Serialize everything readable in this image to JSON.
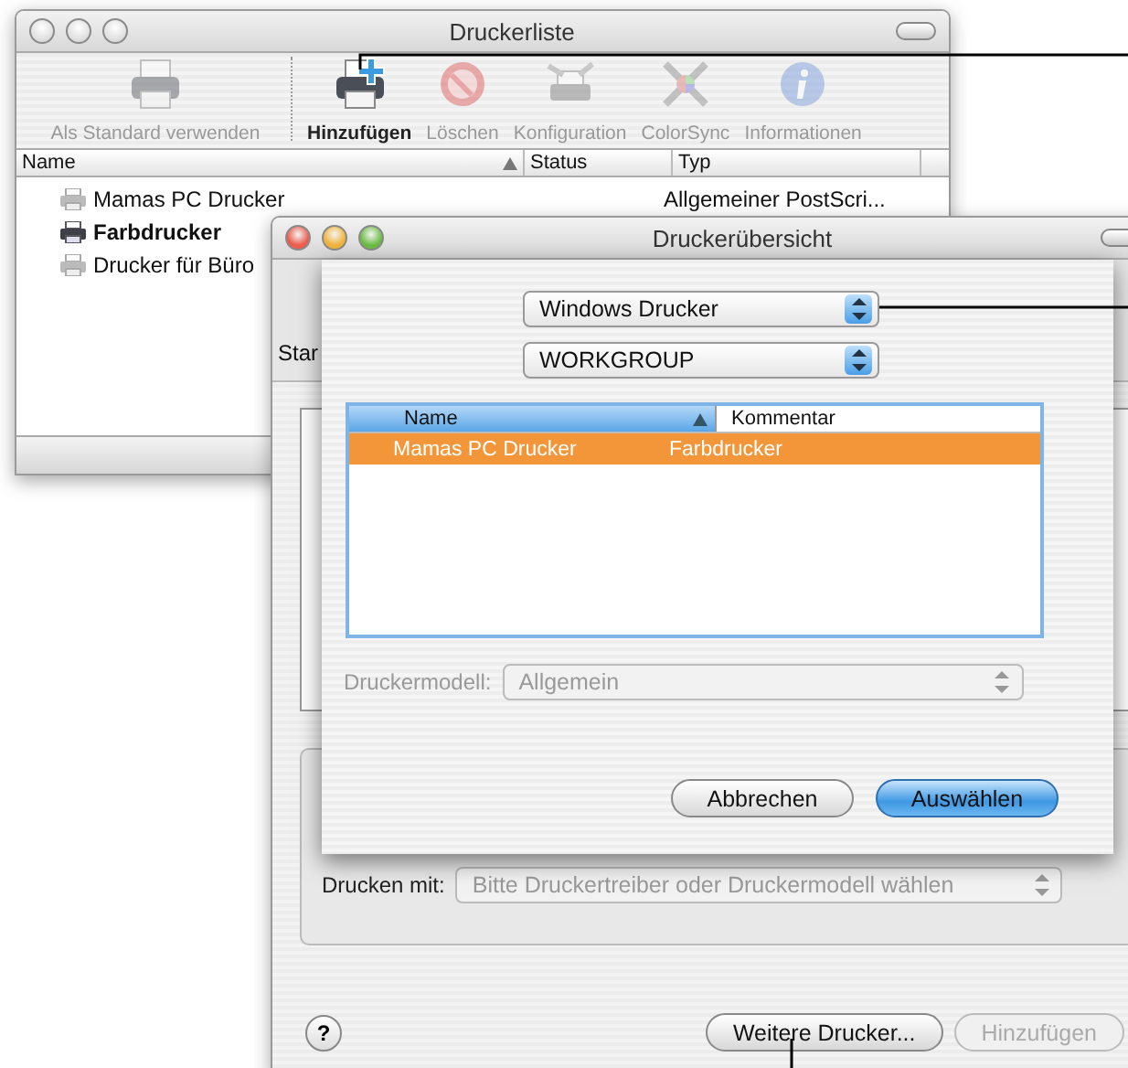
{
  "printer_list_window": {
    "title": "Druckerliste",
    "active": false,
    "toolbar": [
      {
        "label": "Als Standard verwenden",
        "disabled": true
      },
      {
        "label": "Hinzufügen",
        "disabled": false
      },
      {
        "label": "Löschen",
        "disabled": true
      },
      {
        "label": "Konfiguration",
        "disabled": true
      },
      {
        "label": "ColorSync",
        "disabled": true
      },
      {
        "label": "Informationen",
        "disabled": true
      }
    ],
    "columns": [
      "Name",
      "Status",
      "Typ"
    ],
    "rows": [
      {
        "name": "Mamas PC Drucker",
        "type": "Allgemeiner PostScri...",
        "default": false
      },
      {
        "name": "Farbdrucker",
        "default": true
      },
      {
        "name": "Drucker für Büro",
        "default": false
      }
    ]
  },
  "printer_browser_window": {
    "title": "Druckerübersicht",
    "active": true,
    "partial_label": "Star",
    "sheet": {
      "connection_popup": "Windows Drucker",
      "workgroup_popup": "WORKGROUP",
      "columns": [
        "Name",
        "Kommentar"
      ],
      "rows": [
        {
          "name": "Mamas PC Drucker",
          "comment": "Farbdrucker",
          "selected": true
        }
      ],
      "model_label": "Druckermodell:",
      "model_popup": {
        "value": "Allgemein",
        "disabled": true
      },
      "buttons": [
        {
          "label": "Abbrechen",
          "default": false
        },
        {
          "label": "Auswählen",
          "default": true
        }
      ]
    },
    "print_with_label": "Drucken mit:",
    "print_with_popup": "Bitte Druckertreiber oder Druckermodell wählen",
    "help_button": "?",
    "more_printers_button": "Weitere Drucker...",
    "add_button": {
      "label": "Hinzufügen",
      "disabled": true
    }
  }
}
